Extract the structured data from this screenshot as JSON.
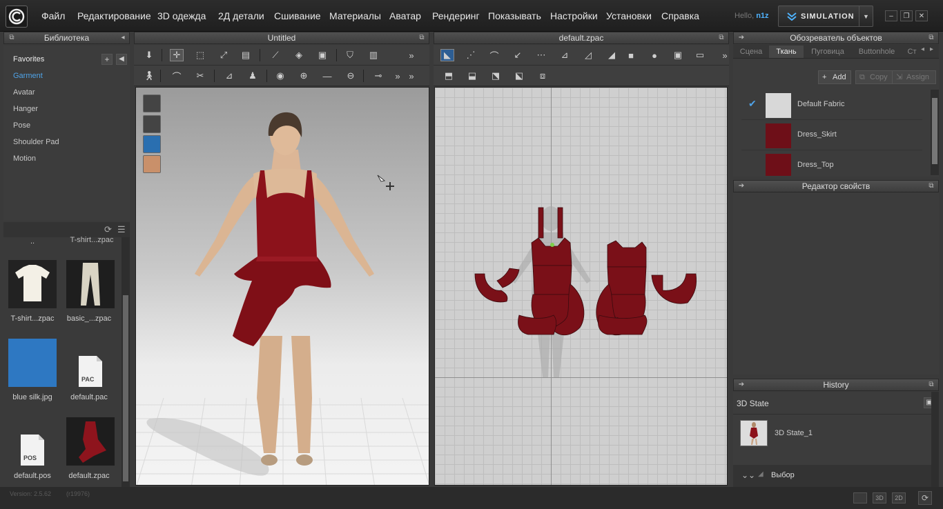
{
  "menu": {
    "items": [
      "Файл",
      "Редактирование",
      "3D одежда",
      "2Д детали",
      "Сшивание",
      "Материалы",
      "Аватар",
      "Рендеринг",
      "Показывать",
      "Настройки",
      "Установки",
      "Справка"
    ],
    "hello": "Hello,",
    "user": "n1z",
    "simulation": "SIMULATION"
  },
  "library": {
    "title": "Библиотека",
    "categories": [
      "Favorites",
      "Garment",
      "Avatar",
      "Hanger",
      "Pose",
      "Shoulder Pad",
      "Motion"
    ],
    "selected": "Garment",
    "up_label": "..",
    "partial_label": "T-shirt...zpac",
    "files": [
      "T-shirt...zpac",
      "basic_...zpac",
      "blue silk.jpg",
      "default.pac",
      "default.pos",
      "default.zpac"
    ],
    "pac_text": "PAC",
    "pos_text": "POS"
  },
  "view3d": {
    "title": "Untitled"
  },
  "view2d": {
    "title": "default.zpac"
  },
  "object_browser": {
    "title": "Обозреватель объектов",
    "tabs": [
      "Сцена",
      "Ткань",
      "Пуговица",
      "Buttonhole",
      "Ст"
    ],
    "active_tab": "Ткань",
    "add": "Add",
    "copy": "Copy",
    "assign": "Assign",
    "fabrics": [
      {
        "name": "Default Fabric",
        "color": "#d8d8d8",
        "checked": true
      },
      {
        "name": "Dress_Skirt",
        "color": "#6e0f18",
        "checked": false
      },
      {
        "name": "Dress_Top",
        "color": "#6e0f18",
        "checked": false
      }
    ]
  },
  "property_editor": {
    "title": "Редактор свойств"
  },
  "history": {
    "title": "History",
    "section": "3D State",
    "item": "3D State_1",
    "select": "Выбор"
  },
  "status": {
    "version": "Version: 2.5.62",
    "revision": "(r19976)",
    "btn_3d": "3D",
    "btn_2d": "2D"
  },
  "colors": {
    "accent": "#4fb3ff",
    "fabric_red": "#7a1018",
    "selected_item": "#4fa3e8"
  }
}
